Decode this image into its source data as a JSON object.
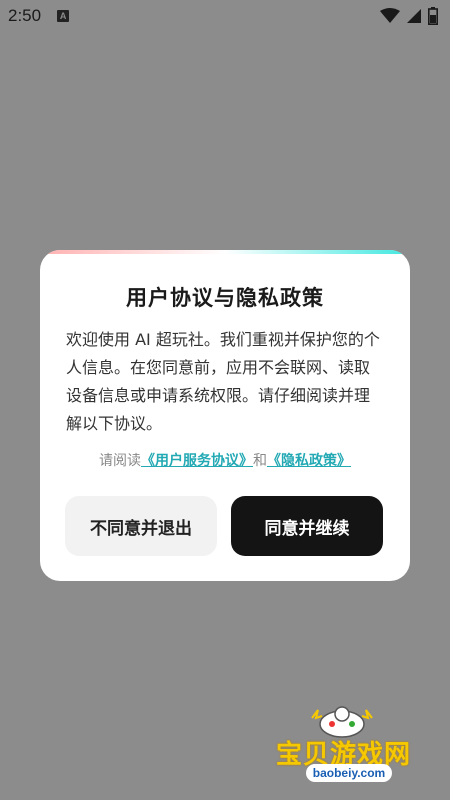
{
  "status_bar": {
    "time": "2:50",
    "notification_icon": "a-icon",
    "wifi_icon": "wifi-icon",
    "signal_icon": "signal-icon",
    "battery_icon": "battery-icon"
  },
  "dialog": {
    "title": "用户协议与隐私政策",
    "body": "欢迎使用 AI 超玩社。我们重视并保护您的个人信息。在您同意前，应用不会联网、读取设备信息或申请系统权限。请仔细阅读并理解以下协议。",
    "links_prefix": "请阅读",
    "terms_link": "《用户服务协议》",
    "links_joiner": "和",
    "privacy_link": "《隐私政策》",
    "decline_label": "不同意并退出",
    "agree_label": "同意并继续"
  },
  "watermark": {
    "brand": "宝贝游戏网",
    "url": "baobeiy.com"
  },
  "colors": {
    "backdrop": "#8c8c8c",
    "link": "#23a9b4",
    "agree_button": "#141414",
    "decline_button": "#f2f2f2"
  }
}
